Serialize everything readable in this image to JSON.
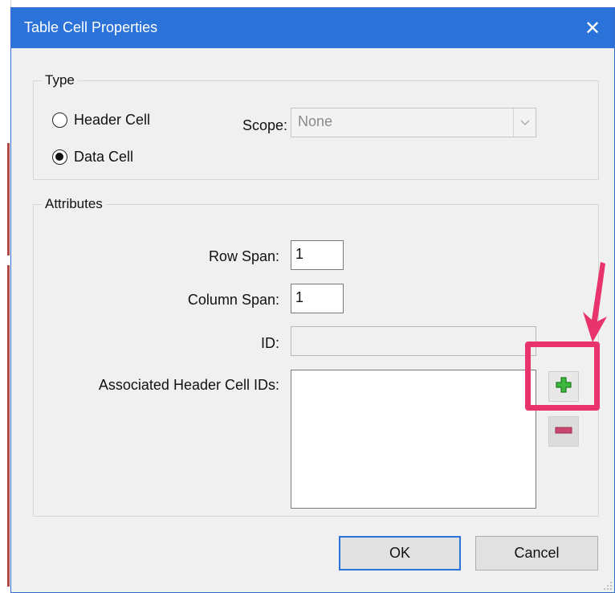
{
  "dialog": {
    "title": "Table Cell Properties",
    "close_label": "✕"
  },
  "type_group": {
    "legend": "Type",
    "header_cell_label": "Header Cell",
    "data_cell_label": "Data Cell",
    "selected": "Data Cell",
    "scope_label": "Scope:",
    "scope_value": "None"
  },
  "attributes_group": {
    "legend": "Attributes",
    "row_span_label": "Row Span:",
    "row_span_value": "1",
    "column_span_label": "Column Span:",
    "column_span_value": "1",
    "id_label": "ID:",
    "id_value": "",
    "associated_label": "Associated Header Cell IDs:",
    "associated_items": []
  },
  "buttons": {
    "ok": "OK",
    "cancel": "Cancel"
  },
  "icons": {
    "add": "plus-icon",
    "remove": "minus-icon",
    "close": "close-icon",
    "dropdown": "chevron-down-icon"
  },
  "colors": {
    "titlebar": "#2b73d8",
    "annotation": "#e8336c",
    "add_icon": "#3db83d",
    "remove_icon": "#c9476e"
  }
}
